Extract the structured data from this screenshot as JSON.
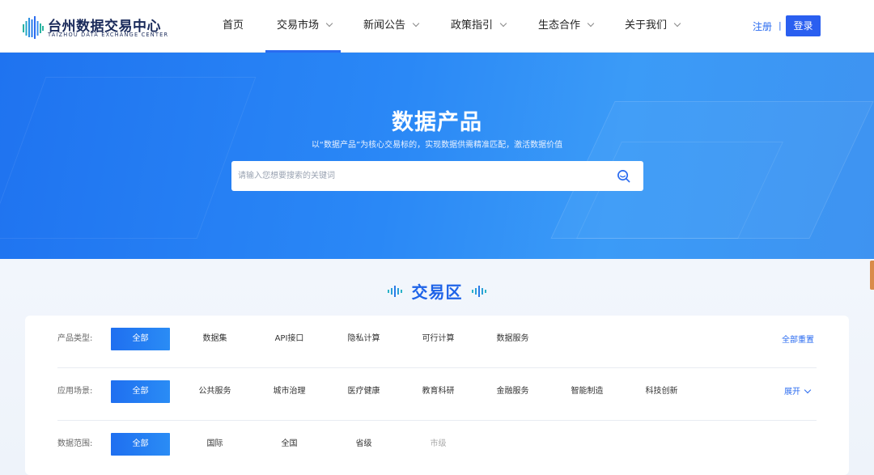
{
  "header": {
    "logo": {
      "cn": "台州数据交易中心",
      "en": "TAIZHOU DATA EXCHANGE CENTER"
    },
    "nav": [
      {
        "label": "首页",
        "has_dropdown": false,
        "active": false
      },
      {
        "label": "交易市场",
        "has_dropdown": true,
        "active": true
      },
      {
        "label": "新闻公告",
        "has_dropdown": true,
        "active": false
      },
      {
        "label": "政策指引",
        "has_dropdown": true,
        "active": false
      },
      {
        "label": "生态合作",
        "has_dropdown": true,
        "active": false
      },
      {
        "label": "关于我们",
        "has_dropdown": true,
        "active": false
      }
    ],
    "register_label": "注册",
    "divider": "|",
    "login_label": "登录"
  },
  "banner": {
    "title": "数据产品",
    "subtitle": "以“数据产品”为核心交易标的，实现数据供需精准匹配，激活数据价值",
    "search": {
      "placeholder": "请输入您想要搜索的关键词",
      "value": ""
    }
  },
  "section": {
    "title": "交易区"
  },
  "filters": [
    {
      "label": "产品类型:",
      "options": [
        "全部",
        "数据集",
        "API接口",
        "隐私计算",
        "可行计算",
        "数据服务"
      ],
      "selected": "全部",
      "right_action": "全部重置"
    },
    {
      "label": "应用场景:",
      "options": [
        "全部",
        "公共服务",
        "城市治理",
        "医疗健康",
        "教育科研",
        "金融服务",
        "智能制造",
        "科技创新"
      ],
      "selected": "全部",
      "right_action": "展开"
    },
    {
      "label": "数据范围:",
      "options": [
        "全部",
        "国际",
        "全国",
        "省级",
        "市级"
      ],
      "selected": "全部",
      "disabled": [
        "市级"
      ]
    }
  ],
  "colors": {
    "accent": "#2a6bf0",
    "banner_start": "#1f73f0",
    "banner_end": "#3e93f1",
    "section_title": "#1e63e8"
  }
}
